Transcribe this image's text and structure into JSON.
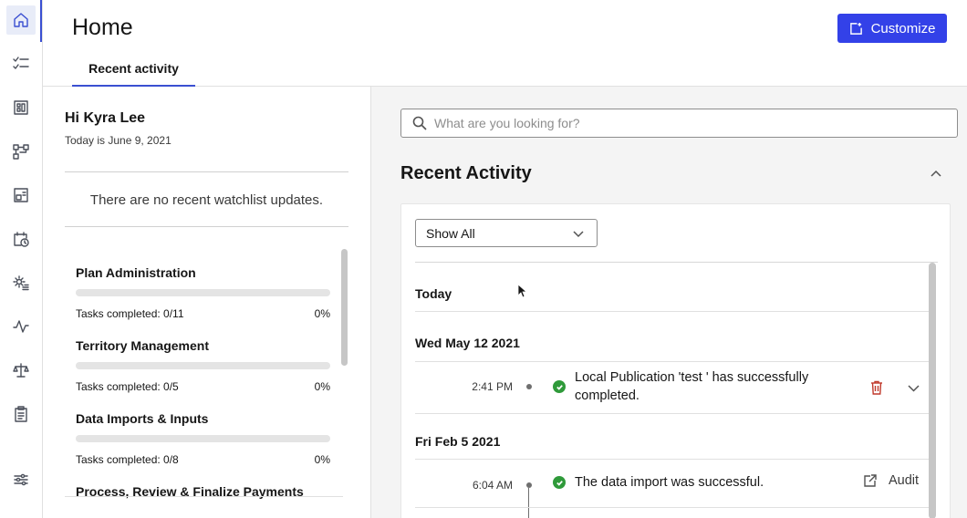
{
  "nav": {
    "items": [
      {
        "icon": "home-icon",
        "active": true
      },
      {
        "icon": "checklist-icon"
      },
      {
        "icon": "dashboard-icon"
      },
      {
        "icon": "workflow-icon"
      },
      {
        "icon": "layout-icon"
      },
      {
        "icon": "calendar-clock-icon"
      },
      {
        "icon": "gear-list-icon"
      },
      {
        "icon": "pulse-icon"
      },
      {
        "icon": "scales-icon"
      },
      {
        "icon": "clipboard-icon"
      }
    ],
    "bottom_icon": "settings-sliders-icon",
    "accent": "#3a4fd1"
  },
  "header": {
    "title": "Home",
    "tab_label": "Recent activity",
    "customize_label": "Customize",
    "button_color": "#3341e8"
  },
  "left": {
    "greeting": "Hi Kyra Lee",
    "date_text": "Today is June 9, 2021",
    "no_updates": "There are no recent watchlist updates.",
    "tasks": [
      {
        "title": "Plan Administration",
        "completed": "Tasks completed: 0/11",
        "percent": "0%",
        "progress": 0
      },
      {
        "title": "Territory Management",
        "completed": "Tasks completed: 0/5",
        "percent": "0%",
        "progress": 0
      },
      {
        "title": "Data Imports & Inputs",
        "completed": "Tasks completed: 0/8",
        "percent": "0%",
        "progress": 0
      },
      {
        "title": "Process, Review & Finalize Payments",
        "completed": "",
        "percent": "",
        "progress": 0
      }
    ]
  },
  "right": {
    "search_placeholder": "What are you looking for?",
    "section_title": "Recent Activity",
    "filter_value": "Show All",
    "days": [
      {
        "label": "Today"
      },
      {
        "label": "Wed May 12 2021"
      },
      {
        "label": "Fri Feb 5 2021"
      }
    ],
    "entries": [
      {
        "time": "2:41 PM",
        "text_line1": "Local Publication 'test ' has successfully",
        "text_line2": "completed.",
        "status": "success"
      },
      {
        "time": "6:04 AM",
        "text_line1": "The data import was successful.",
        "action": "Audit",
        "status": "success"
      }
    ],
    "success_color": "#2f9a3a",
    "delete_color": "#c0392b"
  }
}
